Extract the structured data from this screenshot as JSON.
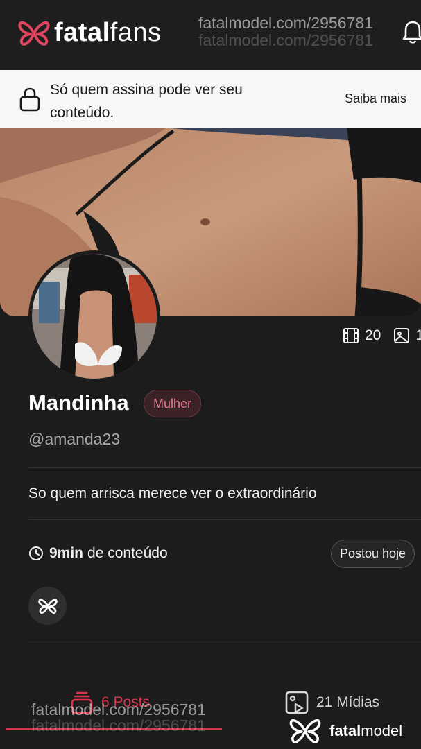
{
  "header": {
    "brand_bold": "fatal",
    "brand_light": "fans",
    "watermark": "fatalmodel.com/2956781"
  },
  "notice": {
    "text": "Só quem assina pode ver seu conteúdo.",
    "link": "Saiba mais"
  },
  "stats": {
    "videos": "20",
    "photos": "1"
  },
  "profile": {
    "name": "Mandinha",
    "badge": "Mulher",
    "handle": "@amanda23",
    "bio": "So quem arrisca merece ver o extraordinário",
    "duration_value": "9min",
    "duration_label": "de conteúdo",
    "posted": "Postou hoje"
  },
  "tabs": {
    "posts": "6 Posts",
    "midias": "21 Mídias"
  },
  "footer": {
    "brand_bold": "fatal",
    "brand_light": "model",
    "watermark": "fatalmodel.com/2956781"
  },
  "colors": {
    "accent": "#d9344d",
    "background": "#1c1c1c",
    "notice_bg": "#f7f7f7"
  }
}
